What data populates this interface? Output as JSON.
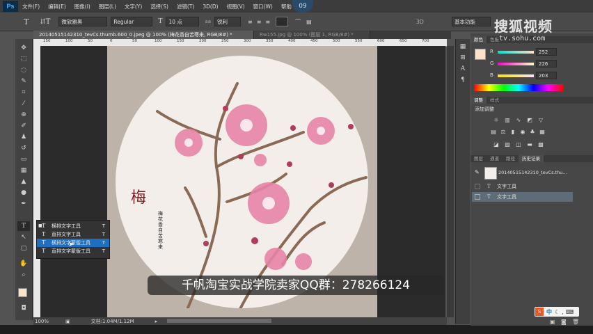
{
  "app": {
    "logo": "Ps",
    "zoom_badge": "09"
  },
  "menu": [
    "文件(F)",
    "编辑(E)",
    "图像(I)",
    "图层(L)",
    "文字(Y)",
    "选择(S)",
    "滤镜(T)",
    "3D(D)",
    "视图(V)",
    "窗口(W)",
    "帮助"
  ],
  "options": {
    "font_family": "微软雅黑",
    "font_style": "Regular",
    "font_size": "10 点",
    "aa": "锐利",
    "mode_3d": "3D",
    "basic_button": "基本功能"
  },
  "tabs": [
    {
      "label": "20140515142310_tevCs.thumb.600_0.jpeg @ 100% (梅花香自苦寒来, RGB/8#) *",
      "active": true
    },
    {
      "label": "Rw155.jpg @ 100% (图层 1, RGB/8#) *",
      "active": false
    }
  ],
  "ruler_ticks": [
    "150",
    "100",
    "50",
    "0",
    "50",
    "100",
    "150",
    "200",
    "250",
    "300",
    "350",
    "400",
    "450",
    "500",
    "550",
    "600",
    "650",
    "700"
  ],
  "canvas": {
    "big_char": "梅",
    "vertical_text": "梅花香自苦寒来"
  },
  "flyout": [
    {
      "icon": "T",
      "label": "横排文字工具",
      "key": "T"
    },
    {
      "icon": "T",
      "label": "直排文字工具",
      "key": "T"
    },
    {
      "icon": "T",
      "label": "横排文字蒙版工具",
      "key": "T"
    },
    {
      "icon": "T",
      "label": "直排文字蒙版工具",
      "key": "T"
    }
  ],
  "status": {
    "zoom": "100%",
    "doc": "文档:1.04M/1.12M"
  },
  "color_panel": {
    "tabs": [
      "颜色",
      "色板"
    ],
    "r_label": "R",
    "g_label": "G",
    "b_label": "B",
    "r": "252",
    "g": "226",
    "b": "203",
    "fg": "#fce2cb"
  },
  "adjust_panel": {
    "tabs": [
      "调整",
      "样式"
    ],
    "title": "添加调整"
  },
  "layers_panel": {
    "tabs": [
      "图层",
      "通道",
      "路径",
      "历史记录"
    ],
    "rows": [
      "20140515142310_tevCs.thu...",
      "文字工具",
      "文字工具"
    ]
  },
  "caption": "千帆淘宝实战学院卖家QQ群：278266124",
  "watermark": {
    "title": "搜狐视频",
    "url": "tv.sohu.com"
  },
  "ime": {
    "label": "中"
  },
  "colors": {
    "accent": "#1e6fbf",
    "canvas_bg": "#bdb3a8",
    "plum_red": "#7c1c25"
  }
}
